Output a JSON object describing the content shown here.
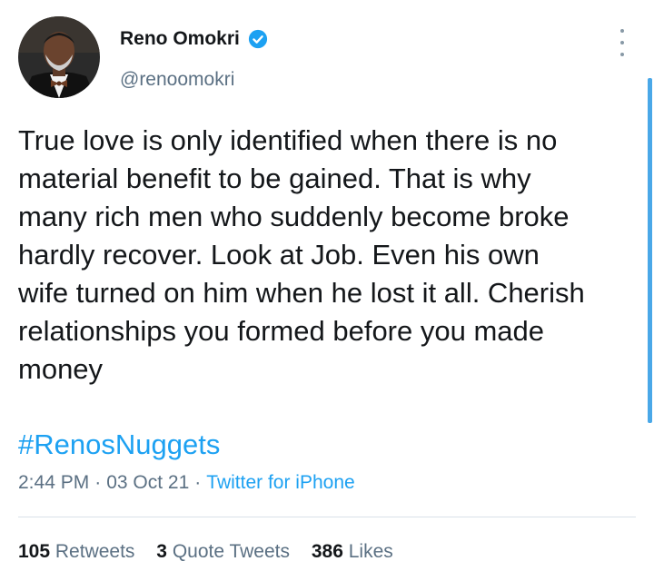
{
  "author": {
    "name": "Reno Omokri",
    "handle": "@renoomokri",
    "verified": true
  },
  "tweet": {
    "lines": [
      "True love is only identified when there is no",
      "material benefit to be gained. That is why",
      "many rich men who suddenly become broke",
      "hardly recover. Look at Job. Even his own",
      "wife turned on him when he lost it all. Cherish",
      "relationships you formed before you made",
      "money"
    ],
    "hashtag": "#RenosNuggets"
  },
  "meta": {
    "time": "2:44 PM",
    "date": "03 Oct 21",
    "source": "Twitter for iPhone",
    "separator": "·"
  },
  "stats": {
    "retweets_count": "105",
    "retweets_label": "Retweets",
    "quotes_count": "3",
    "quotes_label": "Quote Tweets",
    "likes_count": "386",
    "likes_label": "Likes"
  },
  "colors": {
    "link": "#1da1f2",
    "secondary_text": "#5b7083",
    "primary_text": "#14171a",
    "verified": "#1da1f2"
  },
  "icons": {
    "verified": "verified-badge-icon",
    "more": "more-vertical-icon"
  }
}
